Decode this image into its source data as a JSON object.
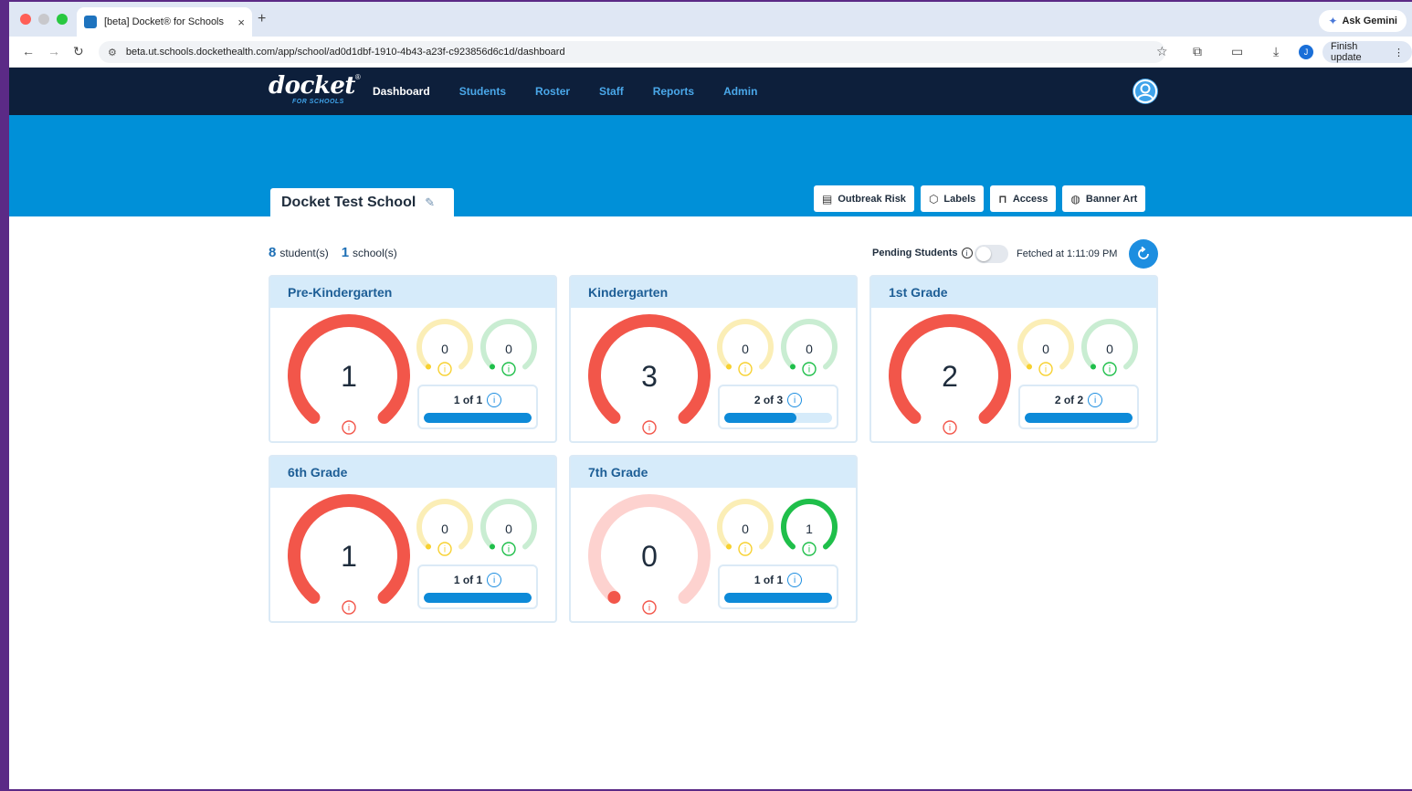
{
  "browser": {
    "tab_title": "[beta] Docket® for Schools",
    "tab_close": "×",
    "new_tab": "+",
    "url": "beta.ut.schools.dockethealth.com/app/school/ad0d1dbf-1910-4b43-a23f-c923856d6c1d/dashboard",
    "ask_gemini": "Ask Gemini",
    "finish_update": "Finish update",
    "profile_initial": "J",
    "icons": [
      "back-icon",
      "forward-icon",
      "reload-icon",
      "site-settings-icon",
      "star-icon",
      "extensions-icon",
      "tab-search-icon",
      "download-icon",
      "menu-icon"
    ]
  },
  "app": {
    "logo_text": "docket",
    "logo_sub": "FOR SCHOOLS",
    "nav": [
      {
        "label": "Dashboard",
        "active": true
      },
      {
        "label": "Students",
        "active": false
      },
      {
        "label": "Roster",
        "active": false
      },
      {
        "label": "Staff",
        "active": false
      },
      {
        "label": "Reports",
        "active": false
      },
      {
        "label": "Admin",
        "active": false
      }
    ]
  },
  "school": {
    "name": "Docket Test School",
    "buttons": [
      {
        "label": "Outbreak Risk",
        "icon": "clipboard-icon"
      },
      {
        "label": "Labels",
        "icon": "tag-icon"
      },
      {
        "label": "Access",
        "icon": "lock-icon"
      },
      {
        "label": "Banner Art",
        "icon": "palette-icon"
      }
    ]
  },
  "summary": {
    "students_count": "8",
    "students_label": "student(s)",
    "schools_count": "1",
    "schools_label": "school(s)",
    "pending_label": "Pending Students",
    "pending_on": false,
    "fetched": "Fetched at 1:11:09 PM"
  },
  "colors": {
    "red": "#f2564a",
    "red_light": "#fdd2cf",
    "yellow": "#f7d130",
    "yellow_light": "#fbeeb6",
    "green": "#1fbf4a",
    "green_light": "#c9edd2",
    "blue": "#0d8ad8",
    "navy": "#0d1f3b",
    "banner": "#0090d8"
  },
  "grades": [
    {
      "name": "Pre-Kindergarten",
      "main": "1",
      "main_fill": 1,
      "yellow": "0",
      "yellow_fill": 0,
      "green": "0",
      "green_fill": 0,
      "stat": "1 of 1",
      "progress": 1.0
    },
    {
      "name": "Kindergarten",
      "main": "3",
      "main_fill": 1,
      "yellow": "0",
      "yellow_fill": 0,
      "green": "0",
      "green_fill": 0,
      "stat": "2 of 3",
      "progress": 0.667
    },
    {
      "name": "1st Grade",
      "main": "2",
      "main_fill": 1,
      "yellow": "0",
      "yellow_fill": 0,
      "green": "0",
      "green_fill": 0,
      "stat": "2 of 2",
      "progress": 1.0
    },
    {
      "name": "6th Grade",
      "main": "1",
      "main_fill": 1,
      "yellow": "0",
      "yellow_fill": 0,
      "green": "0",
      "green_fill": 0,
      "stat": "1 of 1",
      "progress": 1.0
    },
    {
      "name": "7th Grade",
      "main": "0",
      "main_fill": 0,
      "yellow": "0",
      "yellow_fill": 0,
      "green": "1",
      "green_fill": 1,
      "stat": "1 of 1",
      "progress": 1.0
    }
  ]
}
